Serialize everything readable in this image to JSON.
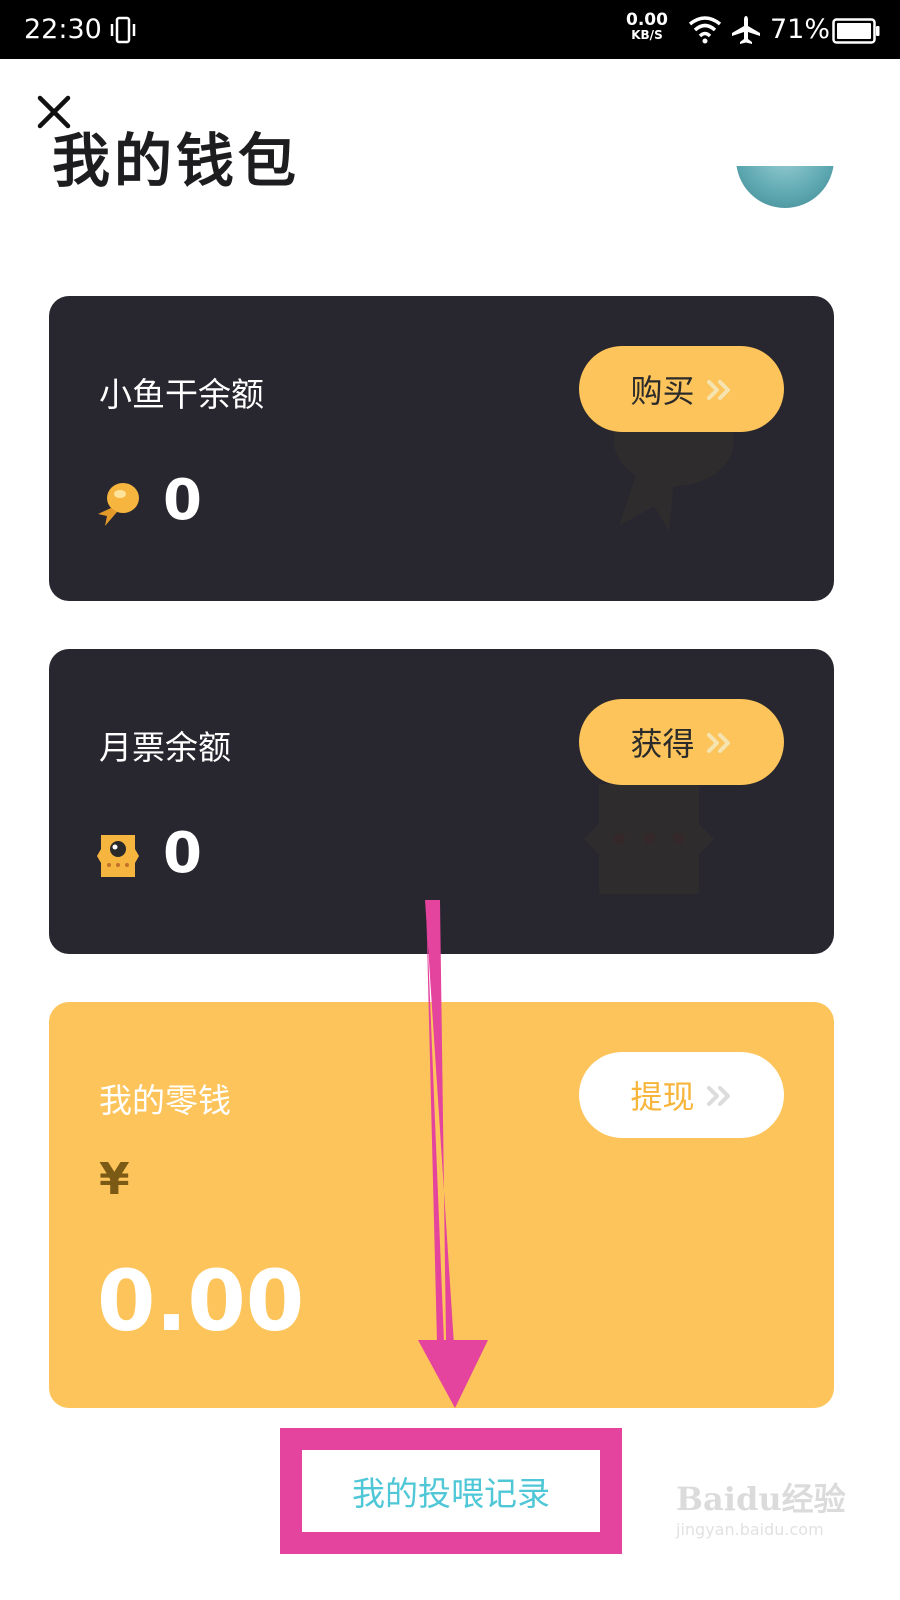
{
  "status_bar": {
    "time": "22:30",
    "net_speed": "0.00",
    "net_unit": "KB/S",
    "battery": "71%"
  },
  "header": {
    "title": "我的钱包"
  },
  "cards": {
    "fish": {
      "label": "小鱼干余额",
      "button": "购买",
      "amount": "0",
      "icon": "fish-coin-icon"
    },
    "ticket": {
      "label": "月票余额",
      "button": "获得",
      "amount": "0",
      "icon": "ticket-icon"
    },
    "change": {
      "label": "我的零钱",
      "button": "提现",
      "currency": "¥",
      "amount": "0.00"
    }
  },
  "footer": {
    "record_link": "我的投喂记录"
  },
  "watermark": {
    "brand": "Baidu经验",
    "site": "jingyan.baidu.com"
  },
  "colors": {
    "accent": "#fcc45a",
    "card_dark": "#28262e",
    "link": "#4fc7d6",
    "annotation": "#e4439e"
  }
}
